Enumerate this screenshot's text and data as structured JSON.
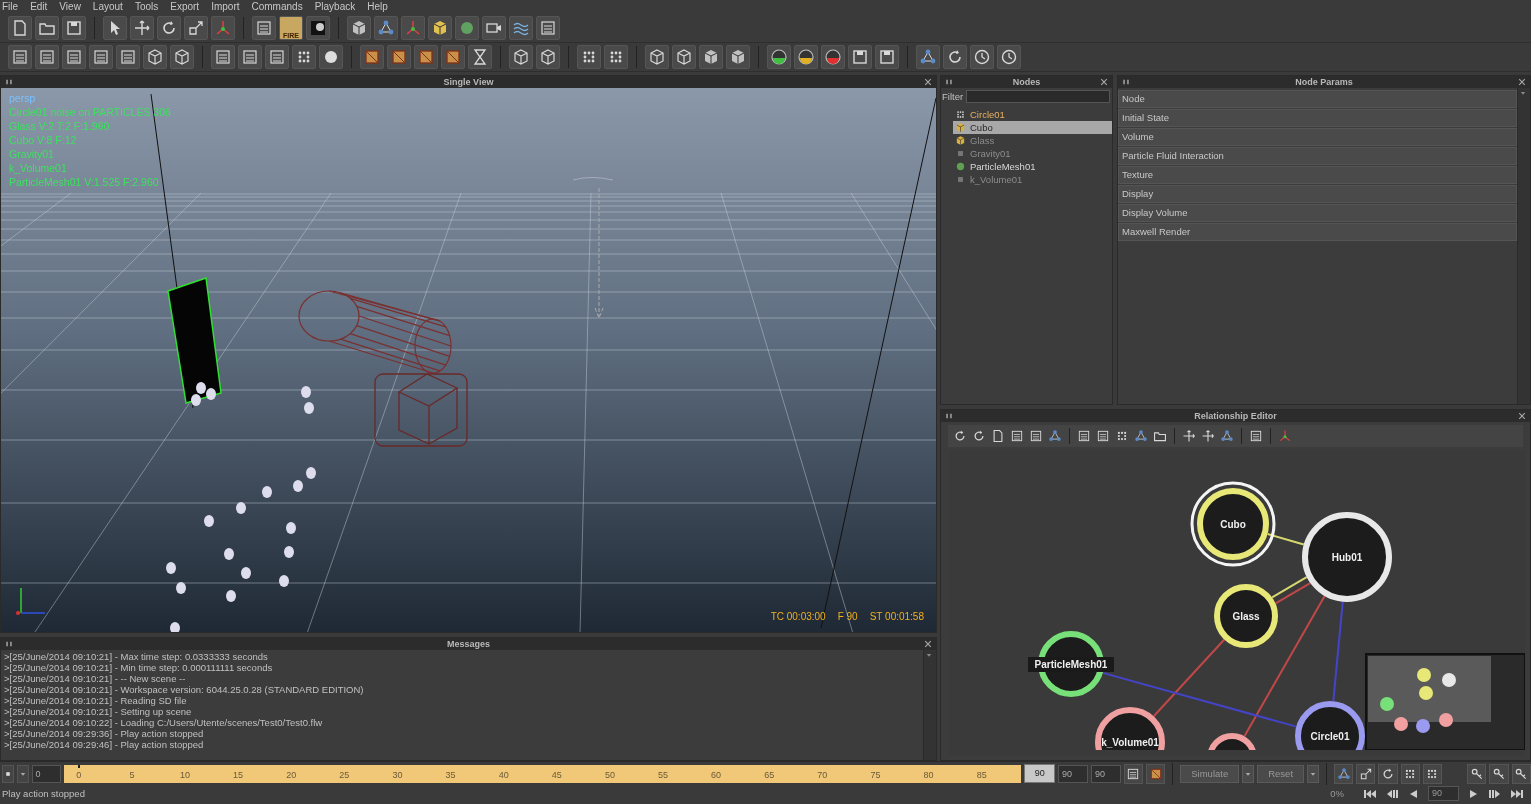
{
  "menu": [
    "File",
    "Edit",
    "View",
    "Layout",
    "Tools",
    "Export",
    "Import",
    "Commands",
    "Playback",
    "Help"
  ],
  "toolbar": {
    "button_caption": "FIRE"
  },
  "viewport": {
    "title": "Single View",
    "overlay": [
      {
        "text": "persp",
        "color": "#78c0ff"
      },
      {
        "text": "Circle01 noise on PARTICLES 306",
        "color": "#3ee060"
      },
      {
        "text": "Glass V:2 T:2 F:1.960",
        "color": "#3ee060"
      },
      {
        "text": "Cubo V:8 F:12",
        "color": "#3ee060"
      },
      {
        "text": "Gravity01",
        "color": "#3ee060"
      },
      {
        "text": "k_Volume01",
        "color": "#3ee060"
      },
      {
        "text": "ParticleMesh01 V:1.525 F:2.960",
        "color": "#3ee060"
      }
    ],
    "timecode": "TC 00:03:00",
    "frame": "F 90",
    "sim_time": "ST 00:01:58"
  },
  "nodes_panel": {
    "title": "Nodes",
    "filter_label": "Filter",
    "items": [
      {
        "label": "Circle01",
        "kind": "emitter",
        "highlighted": true,
        "selected": false,
        "enabled": true
      },
      {
        "label": "Cubo",
        "kind": "object",
        "highlighted": false,
        "selected": true,
        "enabled": true
      },
      {
        "label": "Glass",
        "kind": "object",
        "highlighted": false,
        "selected": false,
        "enabled": false
      },
      {
        "label": "Gravity01",
        "kind": "daemon",
        "highlighted": false,
        "selected": false,
        "enabled": false
      },
      {
        "label": "ParticleMesh01",
        "kind": "mesh",
        "highlighted": false,
        "selected": false,
        "enabled": true
      },
      {
        "label": "k_Volume01",
        "kind": "daemon",
        "highlighted": false,
        "selected": false,
        "enabled": false
      }
    ]
  },
  "params_panel": {
    "title": "Node Params",
    "sections": [
      "Node",
      "Initial State",
      "Volume",
      "Particle Fluid Interaction",
      "Texture",
      "Display",
      "Display Volume",
      "Maxwell Render"
    ]
  },
  "relationship_editor": {
    "title": "Relationship Editor",
    "nodes": [
      {
        "label": "Cubo",
        "color": "#e8e878",
        "selected": true
      },
      {
        "label": "Hub01",
        "color": "#e8e8e8",
        "selected": false
      },
      {
        "label": "Glass",
        "color": "#e8e878",
        "selected": false
      },
      {
        "label": "ParticleMesh01",
        "color": "#78e078",
        "selected": false
      },
      {
        "label": "k_Volume01",
        "color": "#f0a0a0",
        "selected": false
      },
      {
        "label": "Circle01",
        "color": "#9a9af0",
        "selected": false
      },
      {
        "color": "#f0a0a0",
        "selected": false
      }
    ],
    "edges": [
      {
        "color": "#d8d870"
      },
      {
        "color": "#d8d870"
      },
      {
        "color": "#c04848"
      },
      {
        "color": "#c04848"
      },
      {
        "color": "#c04848"
      },
      {
        "color": "#4444c8"
      },
      {
        "color": "#4444c8"
      }
    ]
  },
  "messages": {
    "title": "Messages",
    "lines": [
      ">[25/June/2014 09:10:21] - Max time step: 0.0333333 seconds",
      ">[25/June/2014 09:10:21] - Min time step: 0.000111111 seconds",
      ">[25/June/2014 09:10:21] - -- New scene --",
      ">[25/June/2014 09:10:21] - Workspace version: 6044.25.0.28 (STANDARD EDITION)",
      ">[25/June/2014 09:10:21] - Reading SD file",
      ">[25/June/2014 09:10:21] - Setting up scene",
      ">[25/June/2014 09:10:22] - Loading C:/Users/Utente/scenes/Test0/Test0.flw",
      ">[25/June/2014 09:29:36] - Play action stopped",
      ">[25/June/2014 09:29:46] - Play action stopped"
    ]
  },
  "timeline": {
    "start": "0",
    "ticks": [
      "0",
      "5",
      "10",
      "15",
      "20",
      "25",
      "30",
      "35",
      "40",
      "45",
      "50",
      "55",
      "60",
      "65",
      "70",
      "75",
      "80",
      "85"
    ],
    "end_current": "90",
    "end": "90",
    "end_total": "90"
  },
  "simulation": {
    "simulate": "Simulate",
    "reset": "Reset",
    "progress": "0%",
    "frame": "90"
  },
  "status_bar": "Play action stopped"
}
